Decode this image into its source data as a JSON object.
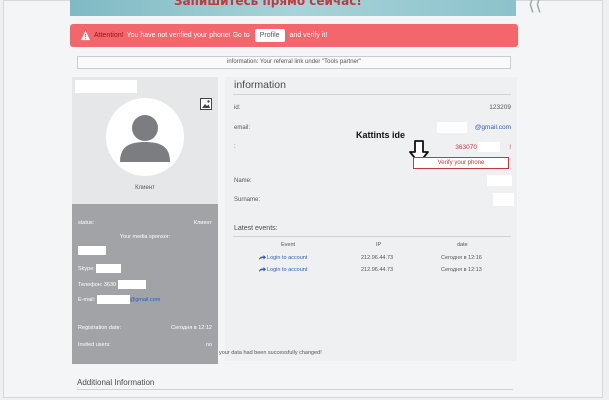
{
  "banner": {
    "text": "Запишитесь прямо сейчас!"
  },
  "alert": {
    "attention": "Attention!",
    "message_before": "You have not verified your phone! Go to",
    "profile_button": "Profile",
    "message_after": "and verify it!",
    "color": "#f3676c"
  },
  "info_bar": {
    "text": "information: Your referral link under \"Tools partner\""
  },
  "profile": {
    "role": "Клиент",
    "status_label": "status:",
    "status_value": "Клиент",
    "sponsor_label": "Your media sponsor:",
    "skype_label": "Skype:",
    "phone_label": "Телефон: 3630",
    "email_label": "E-mail:",
    "email_suffix": "@gmail.com",
    "registration_label": "Registration date:",
    "registration_value": "Сегодня в 12:12",
    "invited_label": "Invited users:",
    "invited_value": "no"
  },
  "information": {
    "title": "information",
    "id_label": "id:",
    "id_value": "123209",
    "email_label": "email:",
    "email_value": "@gmail.com",
    "phone_label": ":",
    "phone_value": "363070",
    "phone_suffix": "!",
    "annotation": "Kattints ide",
    "verify_button": "Verify your phone",
    "name_label": "Name:",
    "surname_label": "Surname:"
  },
  "events": {
    "title": "Latest events:",
    "columns": [
      "Event",
      "IP",
      "date"
    ],
    "rows": [
      {
        "event": "Login to account",
        "ip": "212.96.44.73",
        "date": "Сегодня в 12:16"
      },
      {
        "event": "Login to account",
        "ip": "212.96.44.73",
        "date": "Сегодня в 12:13"
      }
    ]
  },
  "success_message": "your data had been successfully changed!",
  "additional": {
    "title": "Additional Information"
  },
  "colors": {
    "accent_red": "#c0393d",
    "link_blue": "#2d5fb4",
    "grey_panel": "#a1a3a6"
  }
}
